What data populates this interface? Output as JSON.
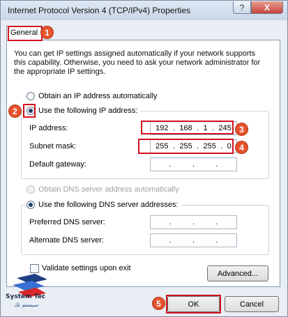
{
  "window": {
    "title": "Internet Protocol Version 4 (TCP/IPv4) Properties",
    "help_glyph": "?",
    "close_glyph": "X"
  },
  "tabs": [
    {
      "label": "General"
    }
  ],
  "description": "You can get IP settings assigned automatically if your network supports this capability. Otherwise, you need to ask your network administrator for the appropriate IP settings.",
  "ip_section": {
    "auto_label": "Obtain an IP address automatically",
    "manual_label": "Use the following IP address:",
    "selected": "manual",
    "ip_address": {
      "label": "IP address:",
      "octets": [
        "192",
        "168",
        "1",
        "245"
      ]
    },
    "subnet_mask": {
      "label": "Subnet mask:",
      "octets": [
        "255",
        "255",
        "255",
        "0"
      ]
    },
    "default_gateway": {
      "label": "Default gateway:",
      "octets": [
        "",
        "",
        "",
        ""
      ]
    }
  },
  "dns_section": {
    "auto_label": "Obtain DNS server address automatically",
    "manual_label": "Use the following DNS server addresses:",
    "selected": "manual",
    "preferred": {
      "label": "Preferred DNS server:",
      "octets": [
        "",
        "",
        "",
        ""
      ]
    },
    "alternate": {
      "label": "Alternate DNS server:",
      "octets": [
        "",
        "",
        "",
        ""
      ]
    }
  },
  "validate_label": "Validate settings upon exit",
  "buttons": {
    "advanced": "Advanced...",
    "ok": "OK",
    "cancel": "Cancel"
  },
  "annotations": [
    "1",
    "2",
    "3",
    "4",
    "5"
  ],
  "logo": {
    "name": "System Tec",
    "sub": "سيستم تك"
  },
  "colors": {
    "highlight": "#d1101f",
    "marker": "#e6522b"
  }
}
